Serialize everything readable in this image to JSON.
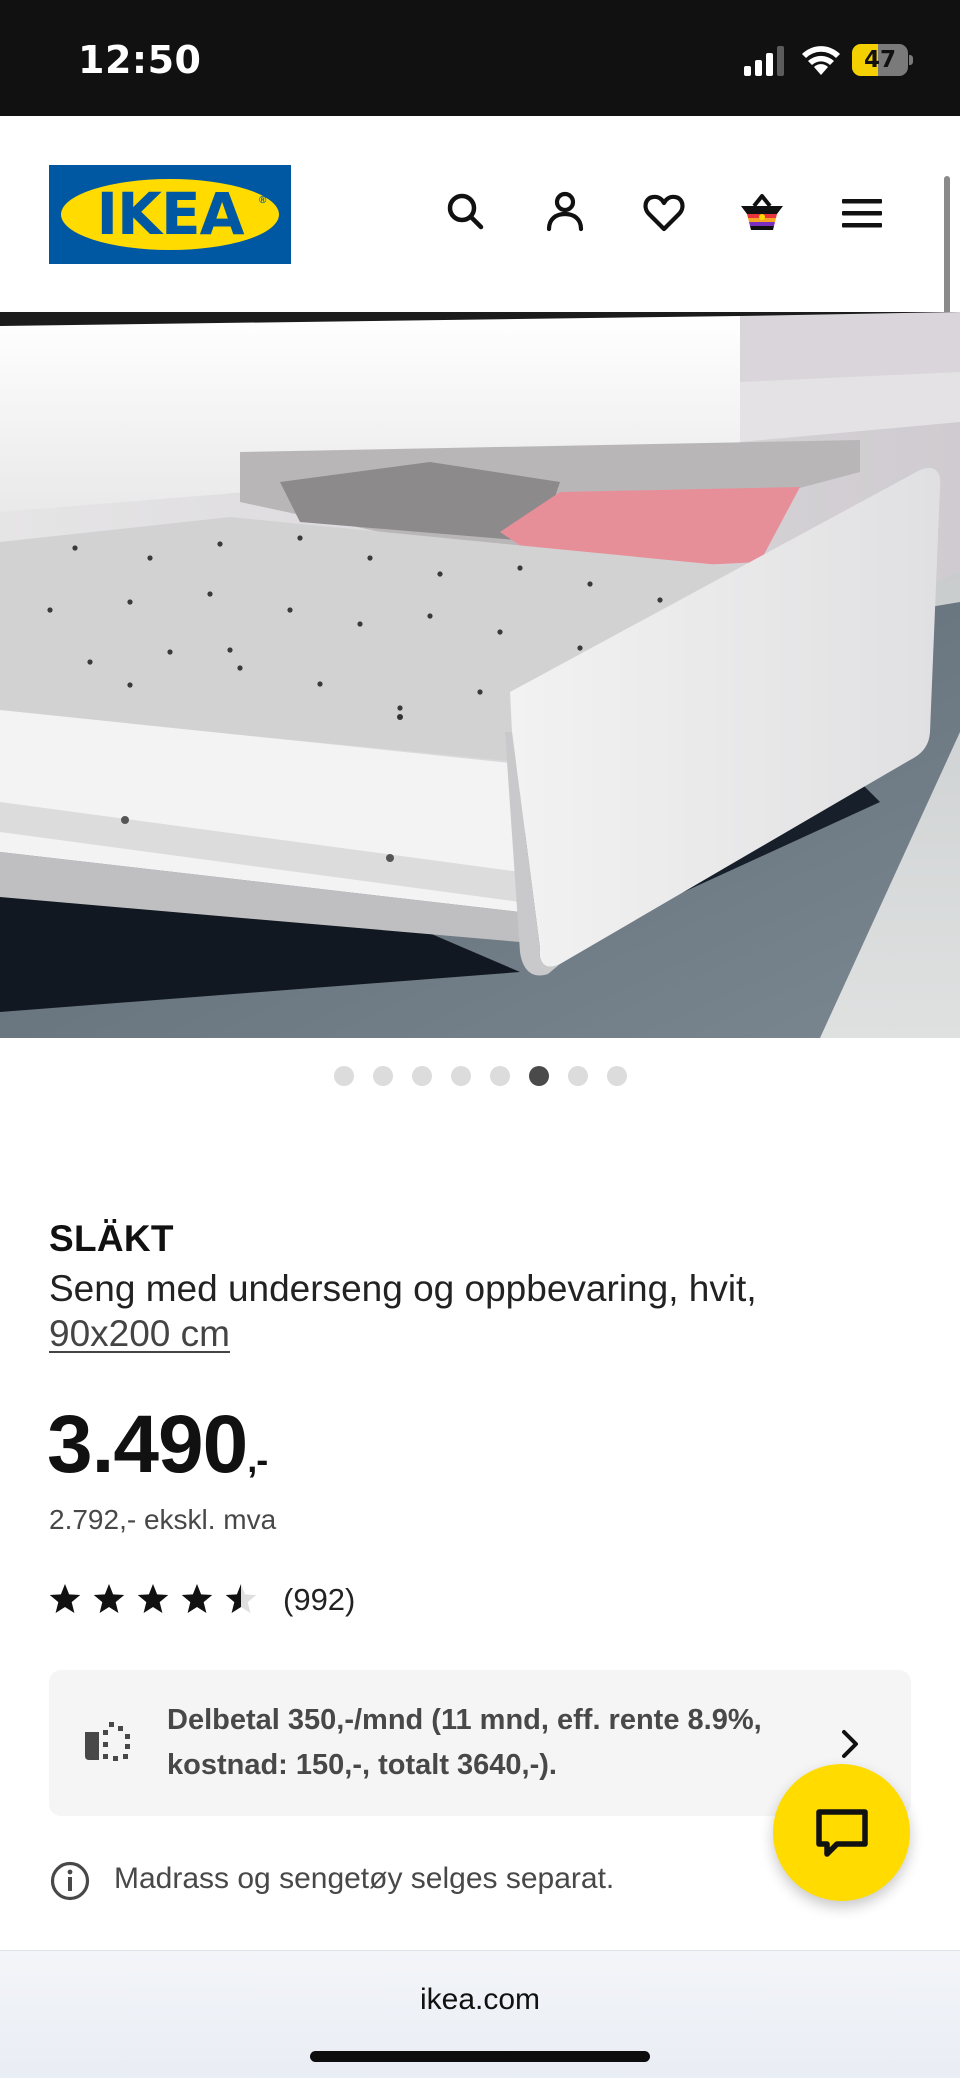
{
  "status_bar": {
    "time": "12:50",
    "battery_level": "47",
    "battery_fraction": 0.47
  },
  "header": {
    "logo_text": "IKEA",
    "icons": [
      "search-icon",
      "account-icon",
      "heart-icon",
      "basket-icon",
      "menu-icon"
    ]
  },
  "gallery": {
    "image_count": 8,
    "active_index": 5
  },
  "product": {
    "brand": "SLÄKT",
    "description": "Seng med underseng og oppbevaring, hvit,",
    "size": "90x200 cm",
    "price_main": "3.490",
    "price_suffix": ",-",
    "price_ex_vat": "2.792,- ekskl. mva",
    "rating": 4.5,
    "review_count": "(992)"
  },
  "financing": {
    "text": "Delbetal 350,-/mnd (11 mnd, eff. rente 8.9%, kostnad: 150,-, totalt 3640,-)."
  },
  "note": {
    "text": "Madrass og sengetøy selges separat."
  },
  "browser": {
    "url": "ikea.com"
  },
  "colors": {
    "ikea_blue": "#0058a3",
    "ikea_yellow": "#ffdb00",
    "status_bar": "#111111",
    "text_secondary": "#484848",
    "panel_bg": "#f5f5f5"
  }
}
